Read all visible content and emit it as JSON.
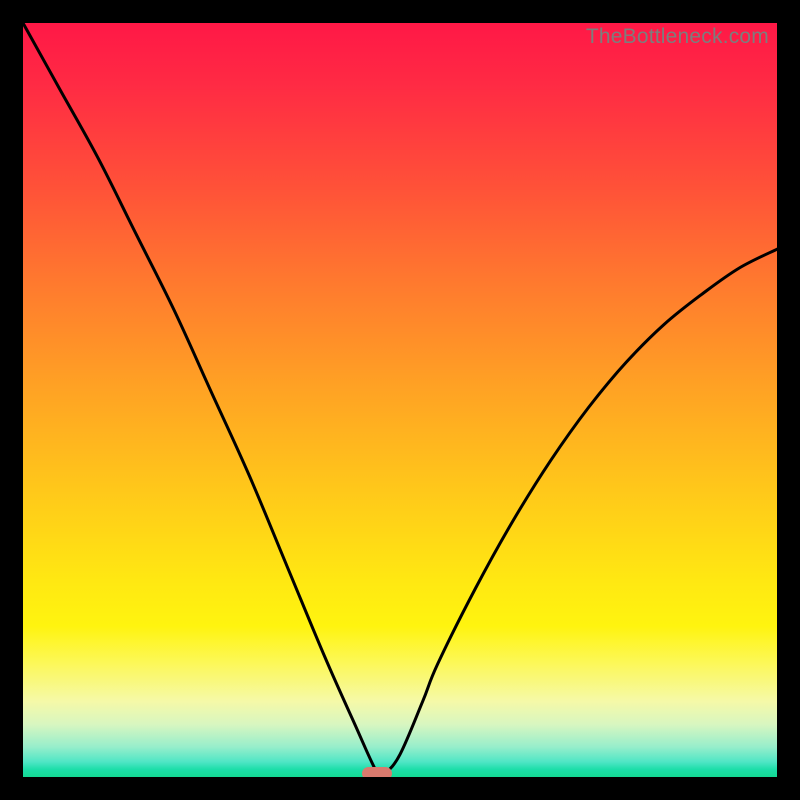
{
  "watermark": "TheBottleneck.com",
  "marker": {
    "x_pct": 47,
    "y_pct": 0
  },
  "colors": {
    "curve_stroke": "#000000",
    "marker_fill": "#d97a6e",
    "frame_bg": "#000000"
  },
  "chart_data": {
    "type": "line",
    "title": "",
    "xlabel": "",
    "ylabel": "",
    "xlim": [
      0,
      100
    ],
    "ylim": [
      0,
      100
    ],
    "series": [
      {
        "name": "bottleneck-curve",
        "x": [
          0,
          5,
          10,
          15,
          20,
          25,
          30,
          35,
          40,
          44,
          47,
          48,
          50,
          53,
          55,
          60,
          65,
          70,
          75,
          80,
          85,
          90,
          95,
          100
        ],
        "values": [
          100,
          91,
          82,
          72,
          62,
          51,
          40,
          28,
          16,
          7,
          0.5,
          0.5,
          3,
          10,
          15,
          25,
          34,
          42,
          49,
          55,
          60,
          64,
          67.5,
          70
        ]
      }
    ],
    "annotations": [
      {
        "type": "marker",
        "x": 47,
        "y": 0,
        "shape": "pill",
        "color": "#d97a6e"
      }
    ]
  }
}
